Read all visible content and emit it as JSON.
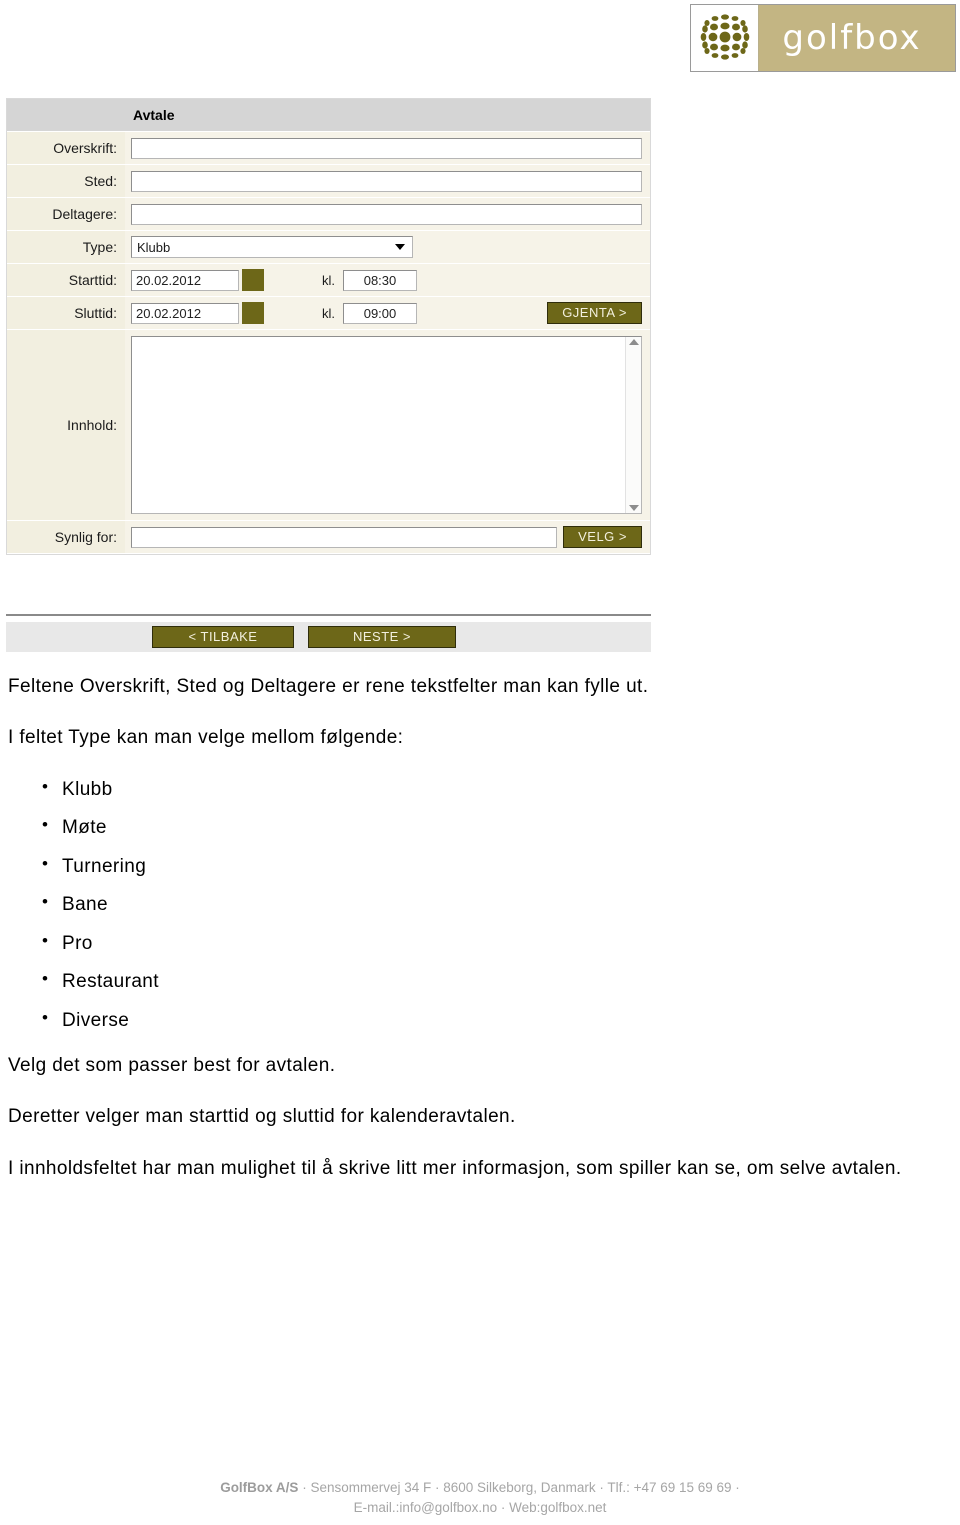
{
  "logo": {
    "wordmark": "golfbox",
    "mark_name": "golfbox-sphere-logo",
    "box_color": "#c3b583",
    "dot_color": "#6d6718"
  },
  "form": {
    "header_label": "",
    "header_title": "Avtale",
    "rows": {
      "overskrift": {
        "label": "Overskrift:",
        "value": ""
      },
      "sted": {
        "label": "Sted:",
        "value": ""
      },
      "deltagere": {
        "label": "Deltagere:",
        "value": ""
      },
      "type": {
        "label": "Type:",
        "selected": "Klubb"
      },
      "starttid": {
        "label": "Starttid:",
        "date": "20.02.2012",
        "kl_label": "kl.",
        "time": "08:30"
      },
      "sluttid": {
        "label": "Sluttid:",
        "date": "20.02.2012",
        "kl_label": "kl.",
        "time": "09:00",
        "repeat_button": "GJENTA >"
      },
      "innhold": {
        "label": "Innhold:",
        "value": ""
      },
      "synlig_for": {
        "label": "Synlig for:",
        "value": "",
        "select_button": "VELG >"
      }
    },
    "colors": {
      "header_bg": "#d5d5d5",
      "label_bg": "#f2efe0",
      "field_bg": "#f6f3e8",
      "button_olive": "#6d6718"
    }
  },
  "nav": {
    "back_button": "< TILBAKE",
    "next_button": "NESTE >",
    "bar_bg": "#e8e8e8"
  },
  "copy": {
    "para1": "Feltene Overskrift, Sted og Deltagere er rene tekstfelter man kan fylle ut.",
    "para2": "I feltet Type kan man velge mellom følgende:",
    "type_options": [
      "Klubb",
      "Møte",
      "Turnering",
      "Bane",
      "Pro",
      "Restaurant",
      "Diverse"
    ],
    "para3": "Velg det som passer best for avtalen.",
    "para4": "Deretter velger man starttid og sluttid for kalenderavtalen.",
    "para5": "I innholdsfeltet har man mulighet til å skrive litt mer informasjon, som spiller kan se, om selve avtalen."
  },
  "footer": {
    "company": "GolfBox A/S",
    "line1_rest": " · Sensommervej 34 F · 8600 Silkeborg, Danmark · Tlf.: +47 69 15 69 69 ·",
    "line2": "E-mail.:info@golfbox.no · Web:golfbox.net"
  }
}
